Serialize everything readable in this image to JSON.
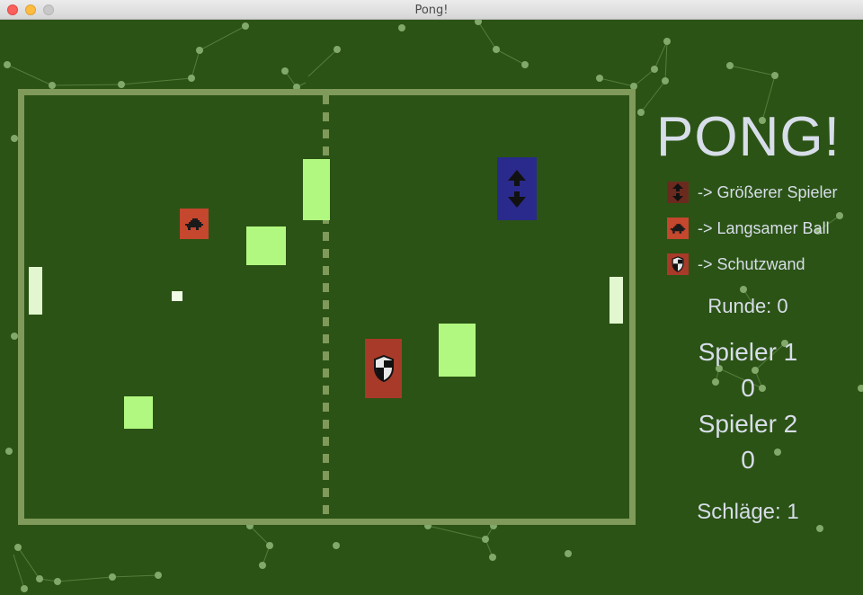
{
  "window": {
    "title": "Pong!"
  },
  "game": {
    "logo": "PONG!",
    "legend": [
      {
        "icon": "bigger-player-icon",
        "text": "-> Größerer Spieler"
      },
      {
        "icon": "turtle-icon",
        "text": "-> Langsamer Ball"
      },
      {
        "icon": "shield-icon",
        "text": "-> Schutzwand"
      }
    ],
    "round_label": "Runde: 0",
    "player1": {
      "name": "Spieler 1",
      "score": "0"
    },
    "player2": {
      "name": "Spieler 2",
      "score": "0"
    },
    "hits_label": "Schläge: 1"
  },
  "colors": {
    "background": "#2b5315",
    "border": "#7f9a5a",
    "block": "#b1f880",
    "paddle": "#e2f7d0",
    "powerup_red": "#a73a28",
    "powerup_blue": "#2a2a8c",
    "text": "#d7dde9"
  }
}
